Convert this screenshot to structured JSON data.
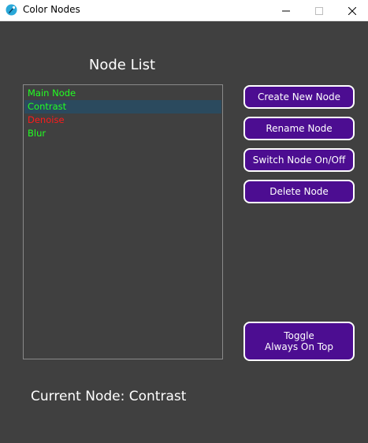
{
  "window": {
    "title": "Color Nodes",
    "icon": "app-logo-icon",
    "controls": [
      "minimize-icon",
      "maximize-icon",
      "close-icon"
    ]
  },
  "node_list": {
    "heading": "Node List",
    "items": [
      {
        "label": "Main Node",
        "color": "#22ff22",
        "selected": false
      },
      {
        "label": "Contrast",
        "color": "#22ff22",
        "selected": true
      },
      {
        "label": "Denoise",
        "color": "#ff1a1a",
        "selected": false
      },
      {
        "label": "Blur",
        "color": "#22ff22",
        "selected": false
      }
    ]
  },
  "buttons": {
    "create": "Create New Node",
    "rename": "Rename Node",
    "switch": "Switch Node On/Off",
    "delete": "Delete Node",
    "toggle_line1": "Toggle",
    "toggle_line2": "Always On Top"
  },
  "status": {
    "current_node": "Current Node: Contrast"
  },
  "colors": {
    "background": "#404040",
    "button": "#4c0d91",
    "selection": "#2b4a5e",
    "enabled_node": "#22ff22",
    "disabled_node": "#ff1a1a"
  }
}
